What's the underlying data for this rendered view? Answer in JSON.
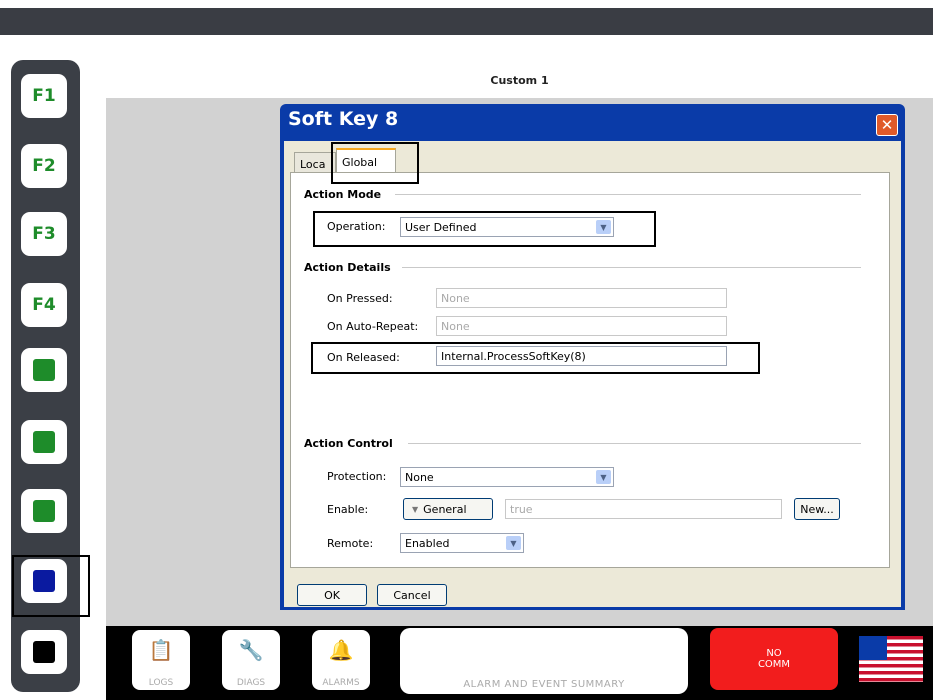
{
  "header": {
    "title": "Custom 1"
  },
  "fkeys": [
    "F1",
    "F2",
    "F3",
    "F4"
  ],
  "softkey_colors": {
    "green": "#1e8c2a",
    "blue": "#0a1aa0",
    "black": "#000000"
  },
  "dialog": {
    "title": "Soft Key 8",
    "close_glyph": "✕",
    "tabs": [
      "Loca",
      "Global"
    ],
    "action_mode": {
      "section": "Action Mode",
      "operation_label": "Operation:",
      "operation_value": "User Defined"
    },
    "action_details": {
      "section": "Action Details",
      "on_pressed_label": "On Pressed:",
      "on_pressed_value": "None",
      "on_auto_repeat_label": "On Auto-Repeat:",
      "on_auto_repeat_value": "None",
      "on_released_label": "On Released:",
      "on_released_value": "Internal.ProcessSoftKey(8)"
    },
    "action_control": {
      "section": "Action Control",
      "protection_label": "Protection:",
      "protection_value": "None",
      "enable_label": "Enable:",
      "enable_mode": "General",
      "enable_value": "true",
      "new_button": "New...",
      "remote_label": "Remote:",
      "remote_value": "Enabled"
    },
    "ok_button": "OK",
    "cancel_button": "Cancel"
  },
  "bottom": {
    "logs": "LOGS",
    "diags": "DIAGS",
    "alarms": "ALARMS",
    "summary": "ALARM AND EVENT SUMMARY",
    "no_comm_line1": "NO",
    "no_comm_line2": "COMM"
  }
}
